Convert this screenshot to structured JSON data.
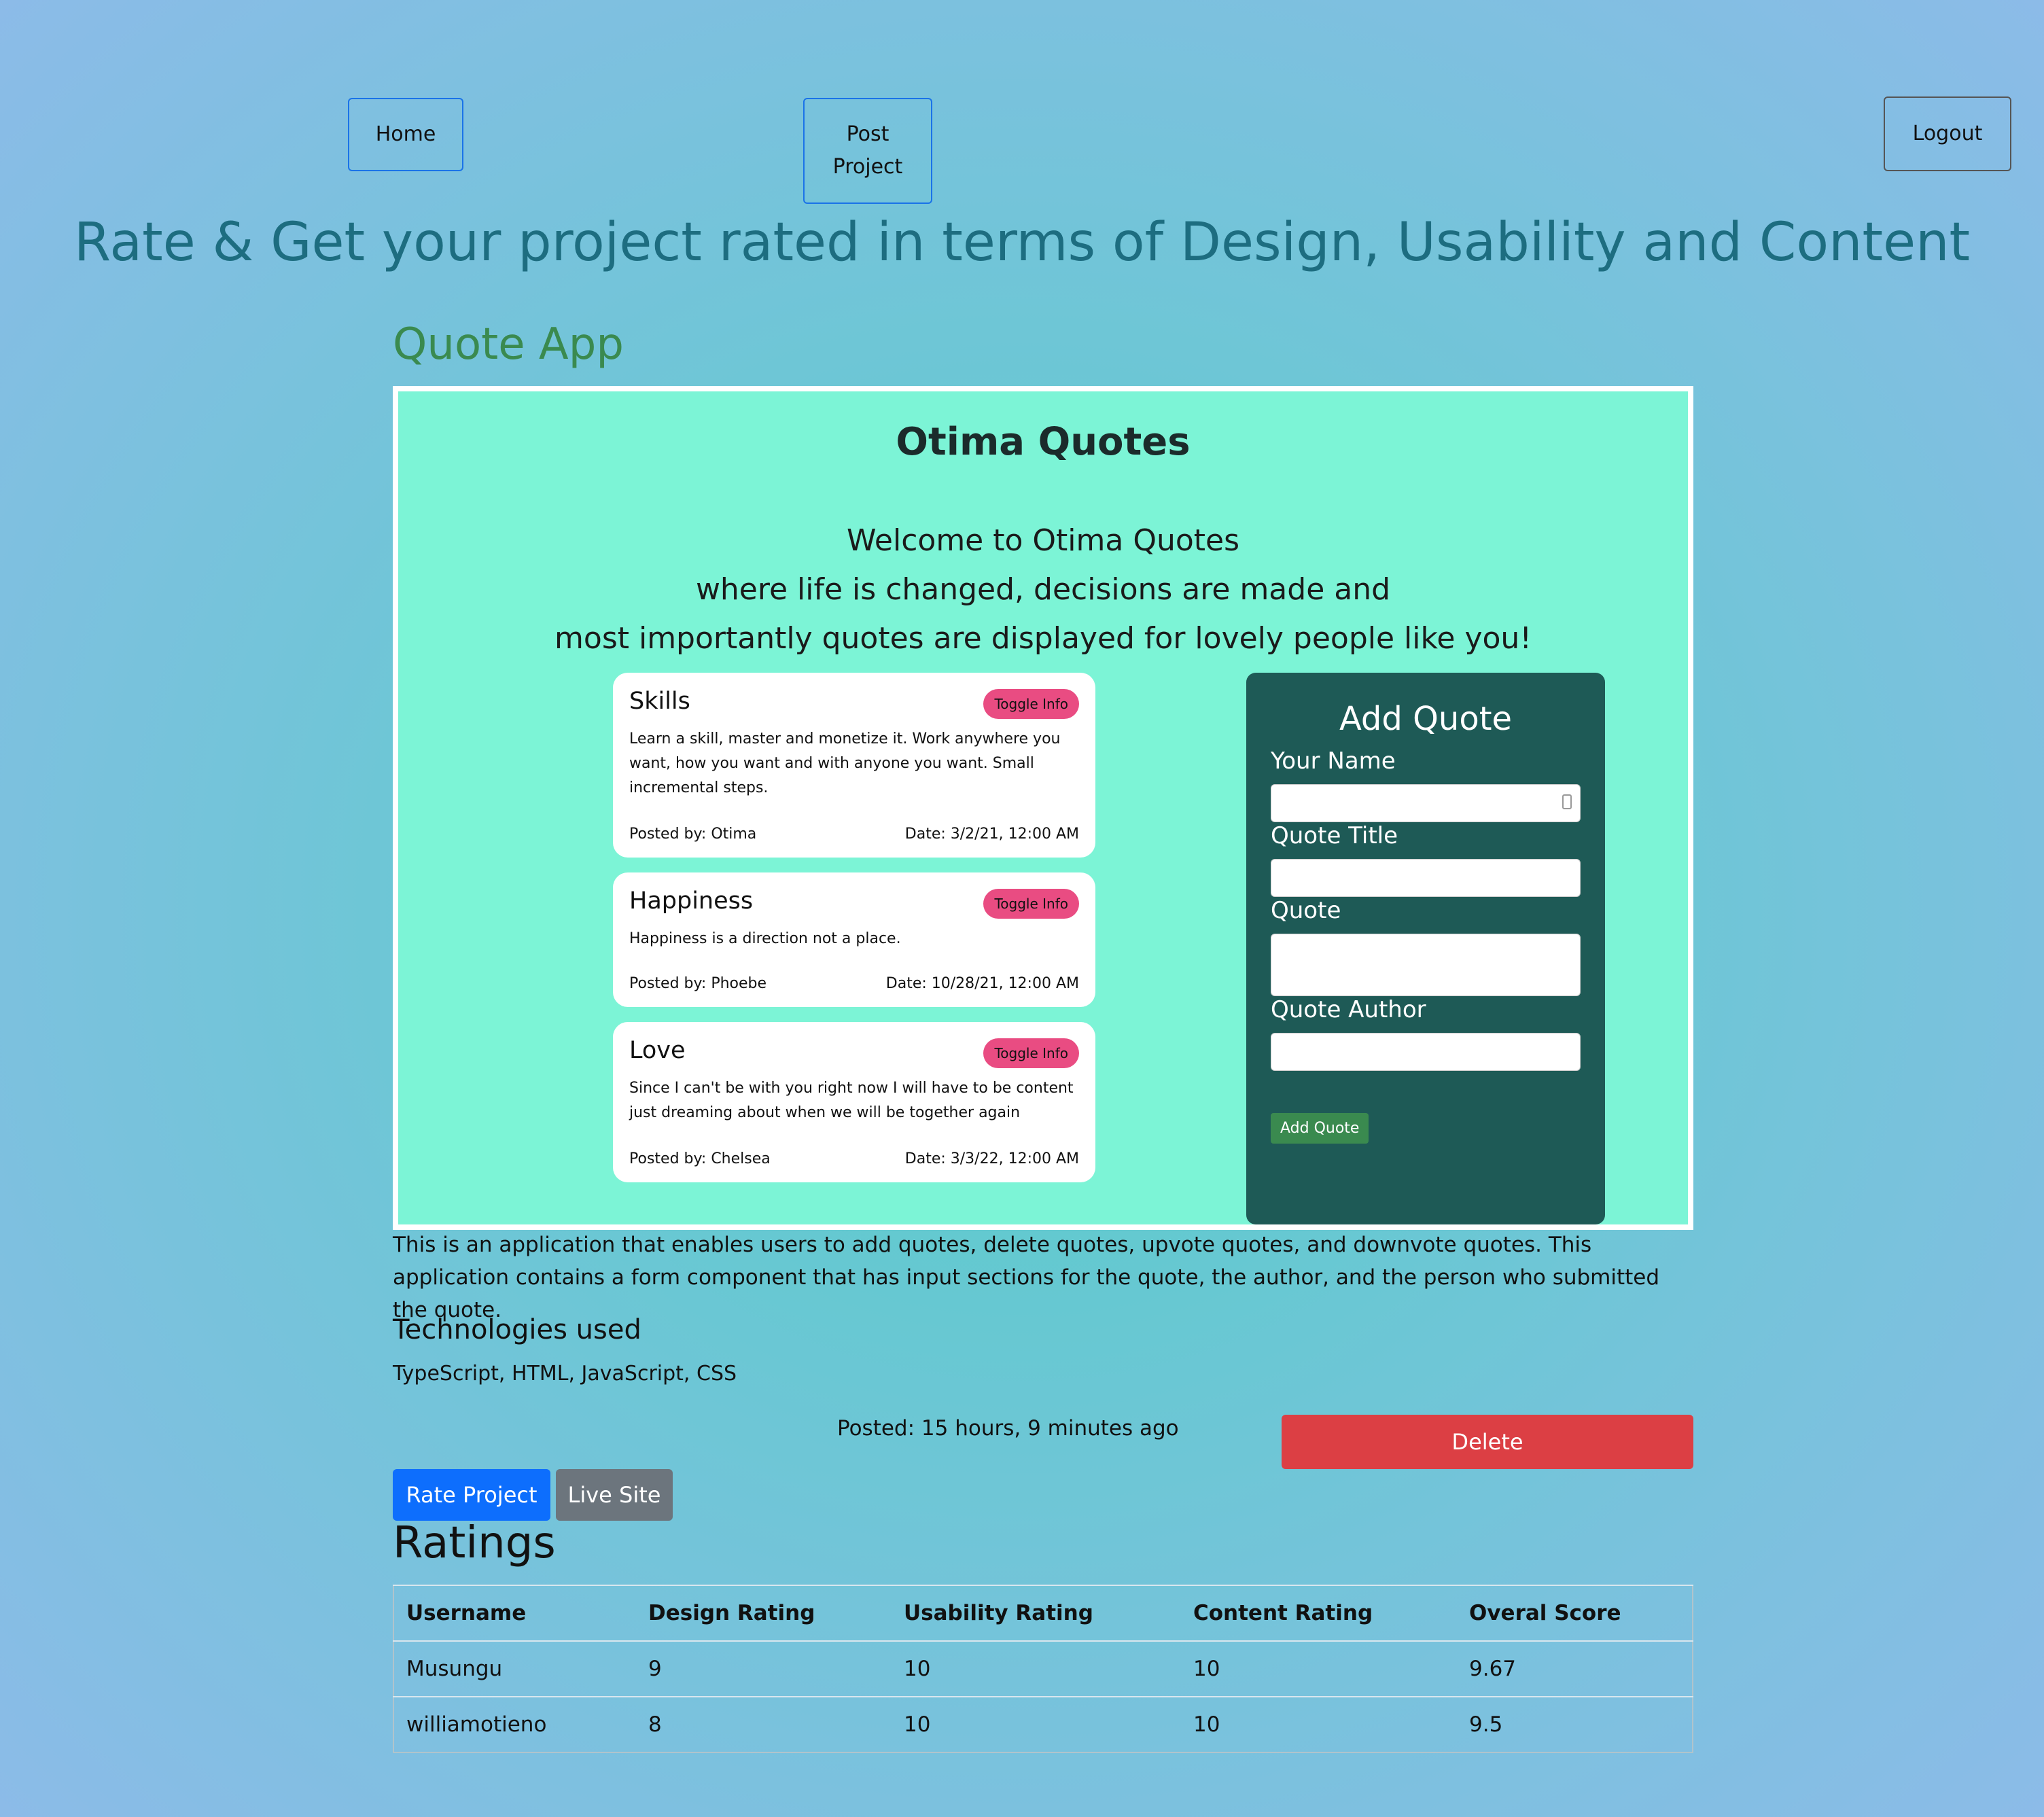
{
  "nav": {
    "home": "Home",
    "post_project": "Post\nProject",
    "logout": "Logout"
  },
  "headline": "Rate & Get your project rated in terms of Design, Usability and Content",
  "project": {
    "title": "Quote App",
    "preview": {
      "app_title": "Otima Quotes",
      "welcome_lines": [
        "Welcome to Otima Quotes",
        "where life is changed, decisions are made and",
        "most importantly quotes are displayed for lovely people like you!"
      ],
      "quotes": [
        {
          "title": "Skills",
          "toggle": "Toggle Info",
          "body": "Learn a skill, master and monetize it. Work anywhere you want, how you want and with anyone you want. Small incremental steps.",
          "posted_by": "Posted by: Otima",
          "date": "Date: 3/2/21, 12:00 AM"
        },
        {
          "title": "Happiness",
          "toggle": "Toggle Info",
          "body": "Happiness is a direction not a place.",
          "posted_by": "Posted by: Phoebe",
          "date": "Date: 10/28/21, 12:00 AM"
        },
        {
          "title": "Love",
          "toggle": "Toggle Info",
          "body": "Since I can't be with you right now I will have to be content just dreaming about when we will be together again",
          "posted_by": "Posted by: Chelsea",
          "date": "Date: 3/3/22, 12:00 AM"
        }
      ],
      "form": {
        "title": "Add Quote",
        "your_name": "Your Name",
        "quote_title": "Quote Title",
        "quote": "Quote",
        "quote_author": "Quote Author",
        "submit": "Add Quote"
      }
    },
    "description": "This is an application that enables users to add quotes, delete quotes, upvote quotes, and downvote quotes. This application contains a form component that has input sections for the quote, the author, and the person who submitted the quote.",
    "technologies_heading": "Technologies used",
    "technologies": "TypeScript, HTML, JavaScript, CSS",
    "posted": "Posted: 15 hours, 9 minutes ago",
    "delete": "Delete",
    "rate": "Rate Project",
    "live": "Live Site"
  },
  "ratings": {
    "heading": "Ratings",
    "columns": [
      "Username",
      "Design Rating",
      "Usability Rating",
      "Content Rating",
      "Overal Score"
    ],
    "rows": [
      [
        "Musungu",
        "9",
        "10",
        "10",
        "9.67"
      ],
      [
        "williamotieno",
        "8",
        "10",
        "10",
        "9.5"
      ]
    ]
  },
  "colors": {
    "accent_blue": "#0d6efd",
    "delete_red": "#dc3f44",
    "headline_teal": "#1d6d80",
    "toggle_pink": "#e94c82",
    "form_bg": "#1e5a56"
  }
}
